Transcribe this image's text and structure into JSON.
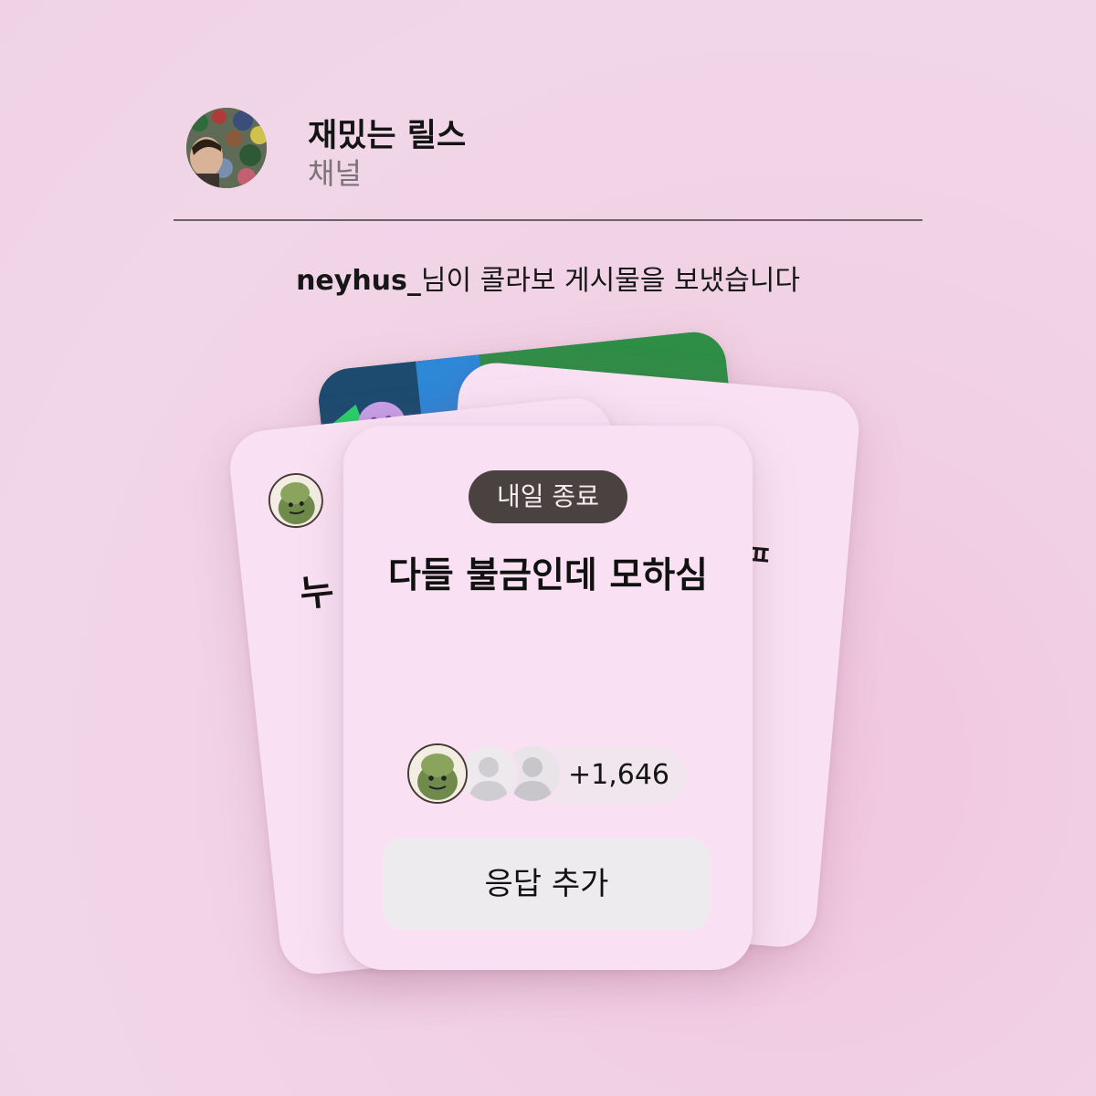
{
  "header": {
    "channel_name": "재밌는 릴스",
    "channel_subtitle": "채널",
    "avatar": "profile-photo"
  },
  "notice": {
    "username": "neyhus_",
    "message": "님이 콜라보 게시물을 보냈습니다"
  },
  "main_card": {
    "deadline_badge": "내일 종료",
    "prompt": "다들 불금인데 모하심",
    "participants": {
      "avatars": [
        "turtle-avatar-icon",
        "default-user-icon",
        "default-user-icon"
      ],
      "extra_count": "+1,646"
    },
    "respond_button": "응답 추가"
  },
  "background_cards": {
    "left_peek_text": "누",
    "right_peek_text": "ㅍ"
  },
  "colors": {
    "background": "#f1d6e8",
    "card": "#f9e1f3",
    "badge": "#4a4241",
    "button": "#eeebef"
  }
}
